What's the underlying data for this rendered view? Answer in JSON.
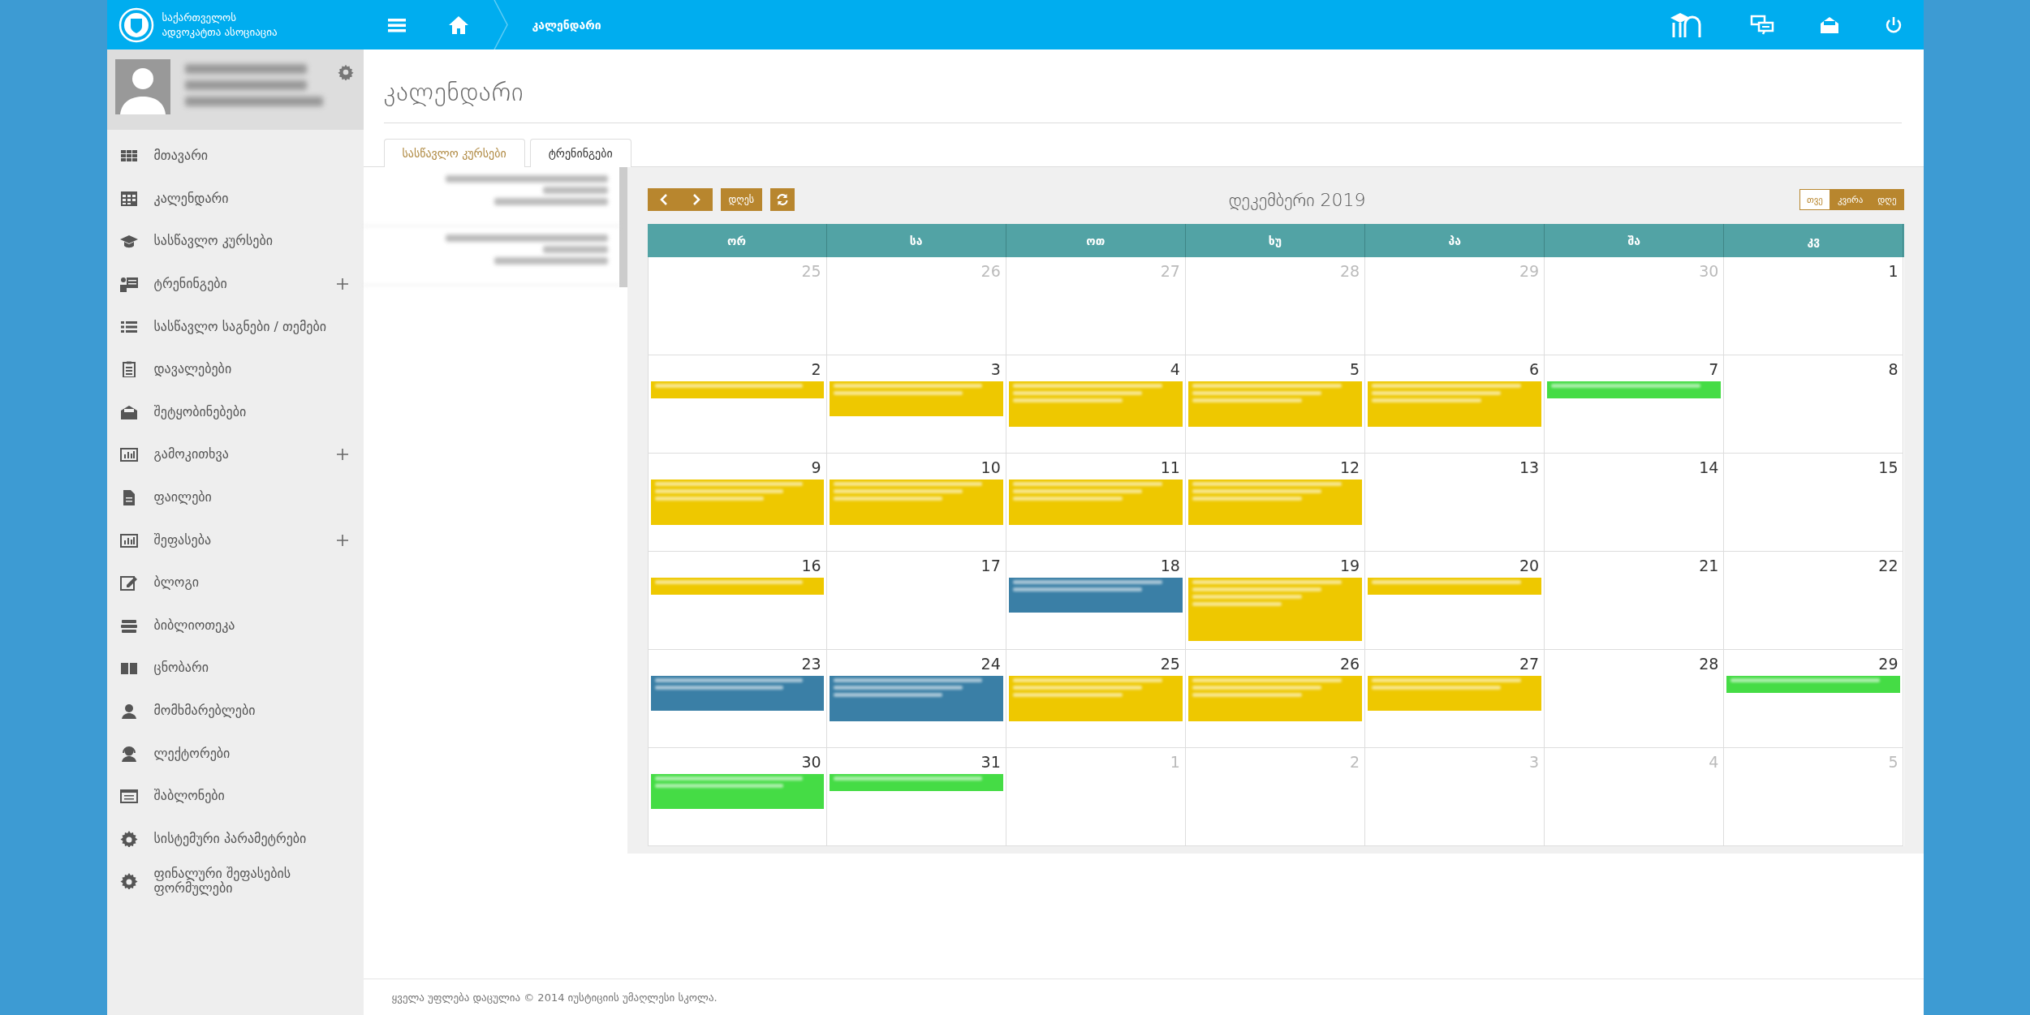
{
  "header": {
    "logo_text": "საქართველოს ადვოკატთა ასოციაცია",
    "breadcrumb": "კალენდარი"
  },
  "sidebar": {
    "items": [
      {
        "label": "მთავარი",
        "expandable": false
      },
      {
        "label": "კალენდარი",
        "expandable": false
      },
      {
        "label": "სასწავლო კურსები",
        "expandable": false
      },
      {
        "label": "ტრენინგები",
        "expandable": true
      },
      {
        "label": "სასწავლო საგნები / თემები",
        "expandable": false
      },
      {
        "label": "დავალებები",
        "expandable": false
      },
      {
        "label": "შეტყობინებები",
        "expandable": false
      },
      {
        "label": "გამოკითხვა",
        "expandable": true
      },
      {
        "label": "ფაილები",
        "expandable": false
      },
      {
        "label": "შეფასება",
        "expandable": true
      },
      {
        "label": "ბლოგი",
        "expandable": false
      },
      {
        "label": "ბიბლიოთეკა",
        "expandable": false
      },
      {
        "label": "ცნობარი",
        "expandable": false
      },
      {
        "label": "მომხმარებლები",
        "expandable": false
      },
      {
        "label": "ლექტორები",
        "expandable": false
      },
      {
        "label": "შაბლონები",
        "expandable": false
      },
      {
        "label": "სისტემური პარამეტრები",
        "expandable": false
      },
      {
        "label": "ფინალური შეფასების ფორმულები",
        "expandable": false
      }
    ]
  },
  "page_title": "კალენდარი",
  "tabs": [
    {
      "label": "სასწავლო კურსები",
      "selected": true
    },
    {
      "label": "ტრენინგები",
      "selected": false
    }
  ],
  "calendar": {
    "today_button": "დღეს",
    "title": "დეკემბერი 2019",
    "views": [
      {
        "label": "თვე",
        "selected": true
      },
      {
        "label": "კვირა",
        "selected": false
      },
      {
        "label": "დღე",
        "selected": false
      }
    ],
    "weekdays": [
      "ორ",
      "სა",
      "ოთ",
      "ხუ",
      "პა",
      "შა",
      "კვ"
    ],
    "weeks": [
      {
        "days": [
          {
            "number": "25",
            "other_month": true
          },
          {
            "number": "26",
            "other_month": true
          },
          {
            "number": "27",
            "other_month": true
          },
          {
            "number": "28",
            "other_month": true
          },
          {
            "number": "29",
            "other_month": true
          },
          {
            "number": "30",
            "other_month": true
          },
          {
            "number": "1",
            "other_month": false
          }
        ]
      },
      {
        "days": [
          {
            "number": "2",
            "other_month": false,
            "events": [
              {
                "color": "#eec800",
                "kind": "short"
              }
            ]
          },
          {
            "number": "3",
            "other_month": false,
            "events": [
              {
                "color": "#eec800",
                "kind": "medium"
              }
            ]
          },
          {
            "number": "4",
            "other_month": false,
            "events": [
              {
                "color": "#eec800",
                "kind": "tall"
              }
            ]
          },
          {
            "number": "5",
            "other_month": false,
            "events": [
              {
                "color": "#eec800",
                "kind": "tall"
              }
            ]
          },
          {
            "number": "6",
            "other_month": false,
            "events": [
              {
                "color": "#eec800",
                "kind": "tall"
              }
            ]
          },
          {
            "number": "7",
            "other_month": false,
            "events": [
              {
                "color": "#45dc45",
                "kind": "short"
              }
            ]
          },
          {
            "number": "8",
            "other_month": false
          }
        ]
      },
      {
        "days": [
          {
            "number": "9",
            "other_month": false,
            "events": [
              {
                "color": "#eec800",
                "kind": "tall"
              }
            ]
          },
          {
            "number": "10",
            "other_month": false,
            "events": [
              {
                "color": "#eec800",
                "kind": "tall"
              }
            ]
          },
          {
            "number": "11",
            "other_month": false,
            "events": [
              {
                "color": "#eec800",
                "kind": "tall"
              }
            ]
          },
          {
            "number": "12",
            "other_month": false,
            "events": [
              {
                "color": "#eec800",
                "kind": "tall"
              }
            ]
          },
          {
            "number": "13",
            "other_month": false
          },
          {
            "number": "14",
            "other_month": false
          },
          {
            "number": "15",
            "other_month": false
          }
        ]
      },
      {
        "days": [
          {
            "number": "16",
            "other_month": false,
            "events": [
              {
                "color": "#eec800",
                "kind": "short"
              }
            ]
          },
          {
            "number": "17",
            "other_month": false
          },
          {
            "number": "18",
            "other_month": false,
            "events": [
              {
                "color": "#3a7fa6",
                "kind": "medium"
              }
            ]
          },
          {
            "number": "19",
            "other_month": false,
            "events": [
              {
                "color": "#eec800",
                "kind": "tallest"
              }
            ]
          },
          {
            "number": "20",
            "other_month": false,
            "events": [
              {
                "color": "#eec800",
                "kind": "short"
              }
            ]
          },
          {
            "number": "21",
            "other_month": false
          },
          {
            "number": "22",
            "other_month": false
          }
        ]
      },
      {
        "days": [
          {
            "number": "23",
            "other_month": false,
            "events": [
              {
                "color": "#3a7fa6",
                "kind": "medium"
              }
            ]
          },
          {
            "number": "24",
            "other_month": false,
            "events": [
              {
                "color": "#3a7fa6",
                "kind": "tall"
              }
            ]
          },
          {
            "number": "25",
            "other_month": false,
            "events": [
              {
                "color": "#eec800",
                "kind": "tall"
              }
            ]
          },
          {
            "number": "26",
            "other_month": false,
            "events": [
              {
                "color": "#eec800",
                "kind": "tall"
              }
            ]
          },
          {
            "number": "27",
            "other_month": false,
            "events": [
              {
                "color": "#eec800",
                "kind": "medium"
              }
            ]
          },
          {
            "number": "28",
            "other_month": false
          },
          {
            "number": "29",
            "other_month": false,
            "events": [
              {
                "color": "#45dc45",
                "kind": "short"
              }
            ]
          }
        ]
      },
      {
        "days": [
          {
            "number": "30",
            "other_month": false,
            "events": [
              {
                "color": "#45dc45",
                "kind": "medium"
              }
            ]
          },
          {
            "number": "31",
            "other_month": false,
            "events": [
              {
                "color": "#45dc45",
                "kind": "short"
              }
            ]
          },
          {
            "number": "1",
            "other_month": true
          },
          {
            "number": "2",
            "other_month": true
          },
          {
            "number": "3",
            "other_month": true
          },
          {
            "number": "4",
            "other_month": true
          },
          {
            "number": "5",
            "other_month": true
          }
        ]
      }
    ]
  },
  "footer": "ყველა უფლება დაცულია © 2014 იუსტიციის უმაღლესი სკოლა."
}
